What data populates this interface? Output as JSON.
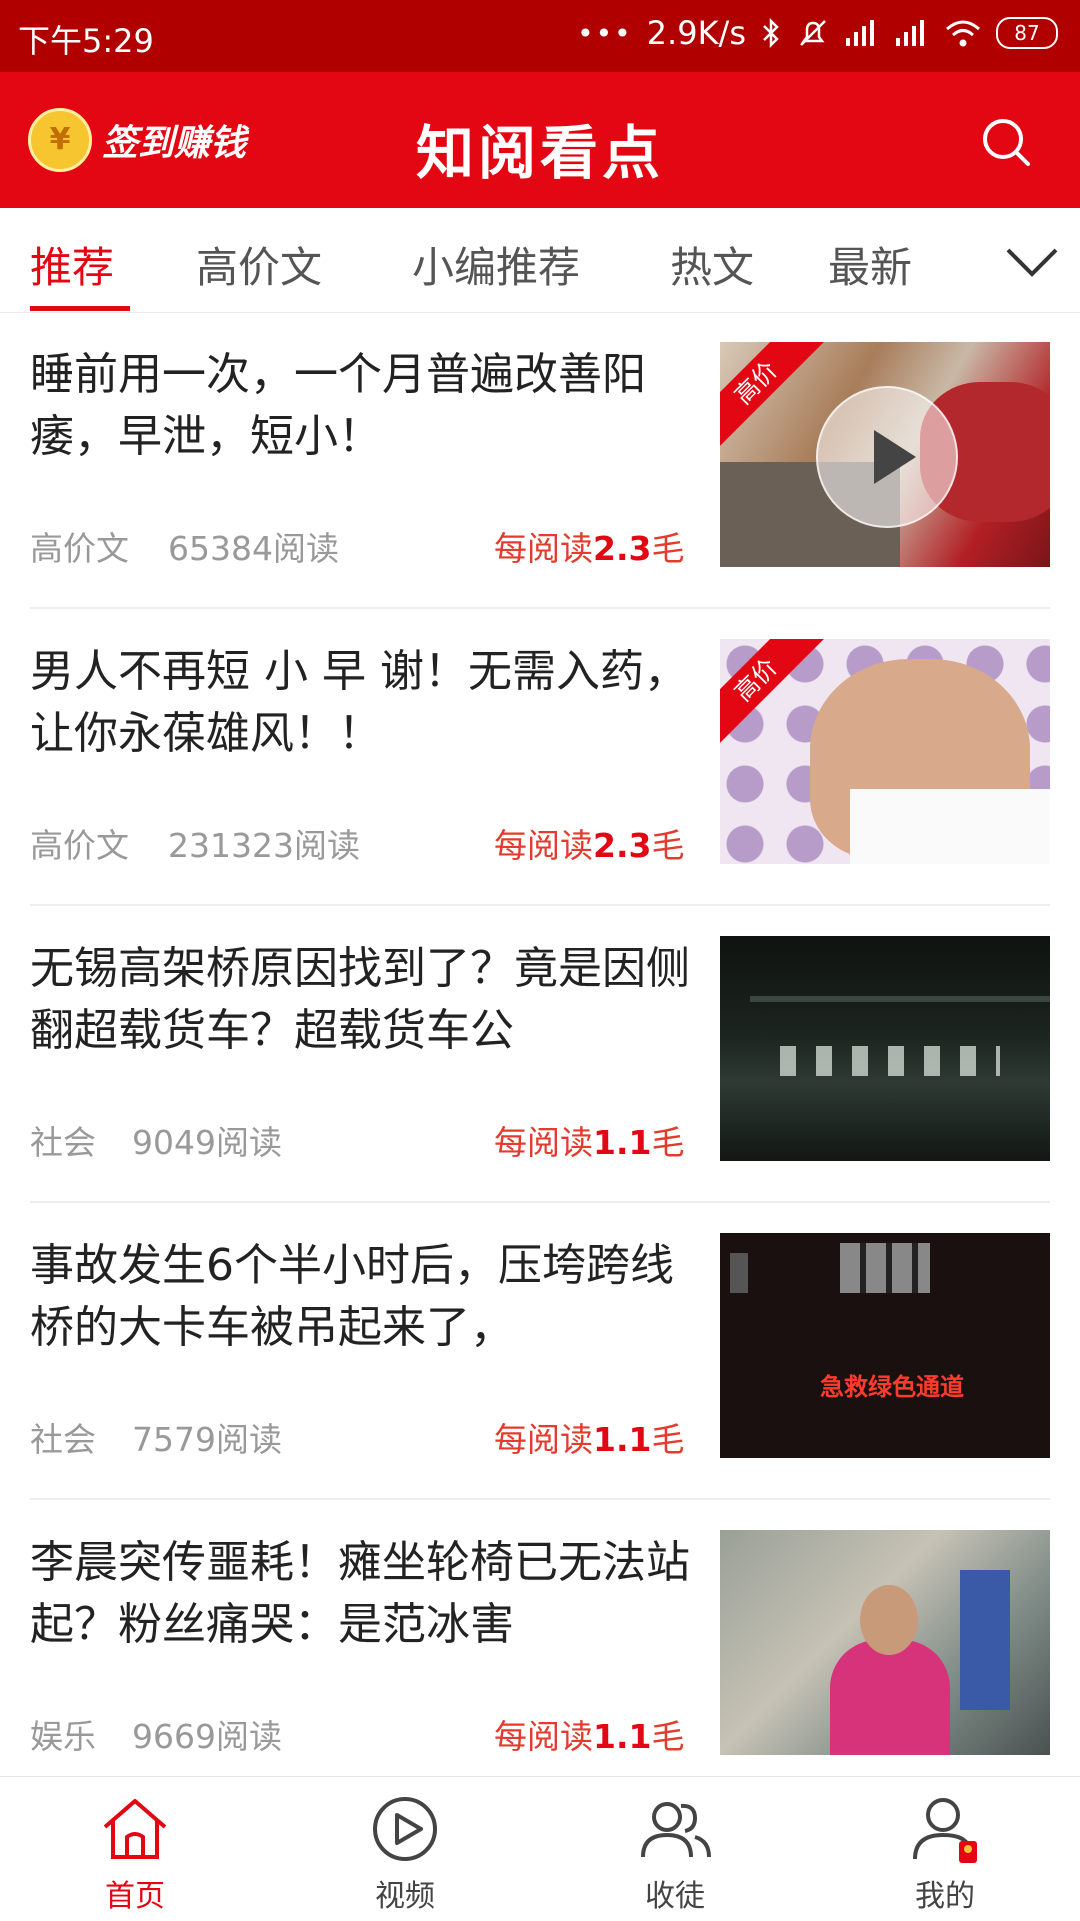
{
  "status_bar": {
    "time": "下午5:29",
    "dots": "•••",
    "speed": "2.9K/s",
    "battery": "87"
  },
  "header": {
    "signin_label": "签到赚钱",
    "coin_symbol": "¥",
    "title": "知阅看点",
    "accent_color": "#e30613"
  },
  "tabs": [
    {
      "label": "推荐",
      "active": true
    },
    {
      "label": "高价文",
      "active": false
    },
    {
      "label": "小编推荐",
      "active": false
    },
    {
      "label": "热文",
      "active": false
    },
    {
      "label": "最新",
      "active": false
    }
  ],
  "articles": [
    {
      "title": "睡前用一次，一个月普遍改善阳痿，早泄，短小！",
      "category": "高价文",
      "reads": "65384阅读",
      "reward_prefix": "每阅读",
      "reward_value": "2.3",
      "reward_unit": "毛",
      "badge": "高价",
      "has_play": true
    },
    {
      "title": "男人不再短 小 早 谢！无需入药，让你永葆雄风！！",
      "category": "高价文",
      "reads": "231323阅读",
      "reward_prefix": "每阅读",
      "reward_value": "2.3",
      "reward_unit": "毛",
      "badge": "高价",
      "has_play": false
    },
    {
      "title": "无锡高架桥原因找到了？竟是因侧翻超载货车？超载货车公",
      "category": "社会",
      "reads": "9049阅读",
      "reward_prefix": "每阅读",
      "reward_value": "1.1",
      "reward_unit": "毛",
      "badge": "",
      "has_play": false
    },
    {
      "title": "事故发生6个半小时后，压垮跨线桥的大卡车被吊起来了，",
      "category": "社会",
      "reads": "7579阅读",
      "reward_prefix": "每阅读",
      "reward_value": "1.1",
      "reward_unit": "毛",
      "badge": "",
      "has_play": false,
      "thumb_text": "急救绿色通道"
    },
    {
      "title": "李晨突传噩耗！瘫坐轮椅已无法站起？粉丝痛哭：是范冰害",
      "category": "娱乐",
      "reads": "9669阅读",
      "reward_prefix": "每阅读",
      "reward_value": "1.1",
      "reward_unit": "毛",
      "badge": "",
      "has_play": false
    }
  ],
  "bottom_nav": [
    {
      "label": "首页",
      "icon": "home-icon",
      "active": true
    },
    {
      "label": "视频",
      "icon": "play-circle-icon",
      "active": false
    },
    {
      "label": "收徒",
      "icon": "users-icon",
      "active": false
    },
    {
      "label": "我的",
      "icon": "user-icon",
      "active": false
    }
  ]
}
